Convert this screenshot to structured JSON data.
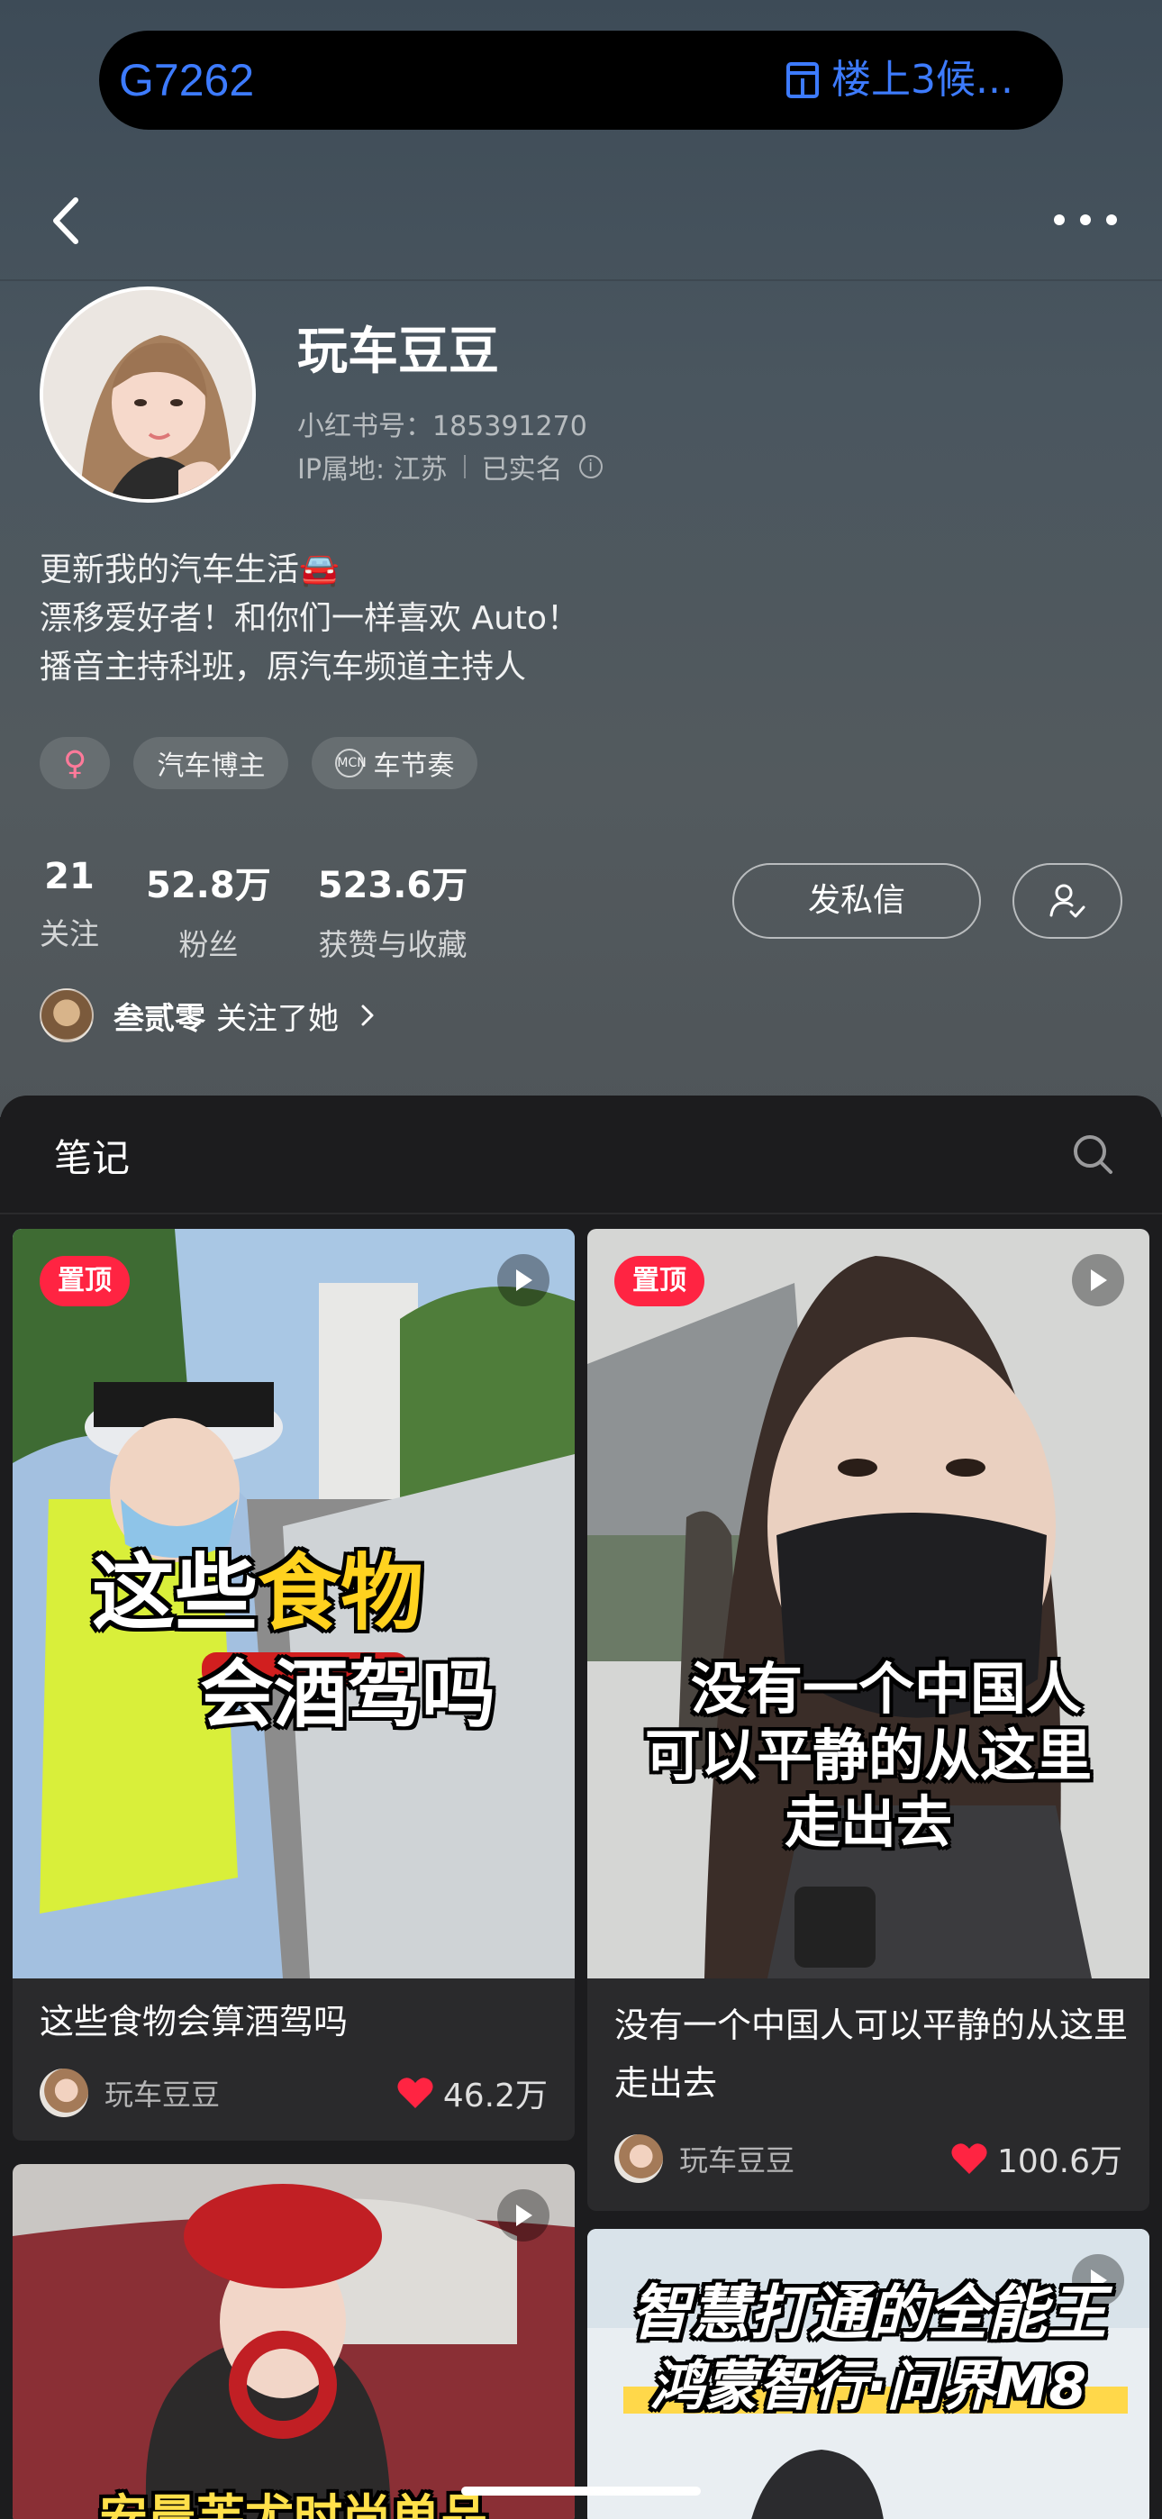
{
  "status": {
    "train": "G7262",
    "station": "楼上3候..."
  },
  "profile": {
    "nickname": "玩车豆豆",
    "xhs_id": "小红书号：185391270",
    "ip": "IP属地: 江苏",
    "verified": "已实名",
    "bio": [
      "更新我的汽车生活🚘",
      "漂移爱好者！和你们一样喜欢 Auto！",
      "播音主持科班，原汽车频道主持人"
    ],
    "tags": {
      "gender": "♀",
      "role": "汽车博主",
      "mcn": "车节奏",
      "mcn_badge": "MCN"
    },
    "stats": [
      {
        "num": "21",
        "label": "关注"
      },
      {
        "num": "52.8万",
        "label": "粉丝"
      },
      {
        "num": "523.6万",
        "label": "获赞与收藏"
      }
    ],
    "message_button": "发私信",
    "mutual": {
      "name": "叁贰零",
      "text": "关注了她"
    }
  },
  "notes": {
    "tab_label": "笔记",
    "pin_label": "置顶",
    "cards": [
      {
        "cover_line1a": "这些",
        "cover_line1b": "食物",
        "cover_line2": "会酒驾吗",
        "title": "这些食物会算酒驾吗",
        "author": "玩车豆豆",
        "likes": "46.2万"
      },
      {
        "cover_line1": "没有一个中国人",
        "cover_line2": "可以平静的从这里",
        "cover_line3": "走出去",
        "title": "没有一个中国人可以平静的从这里走出去",
        "author": "玩车豆豆",
        "likes": "100.6万"
      },
      {
        "cover_text": "安晨芙尤时尚单品"
      },
      {
        "cover_line1": "智慧打通的全能王",
        "cover_line2": "鸿蒙智行·问界M8"
      }
    ]
  },
  "colors": {
    "accent": "#ff2442",
    "island_text": "#3d7bff"
  }
}
